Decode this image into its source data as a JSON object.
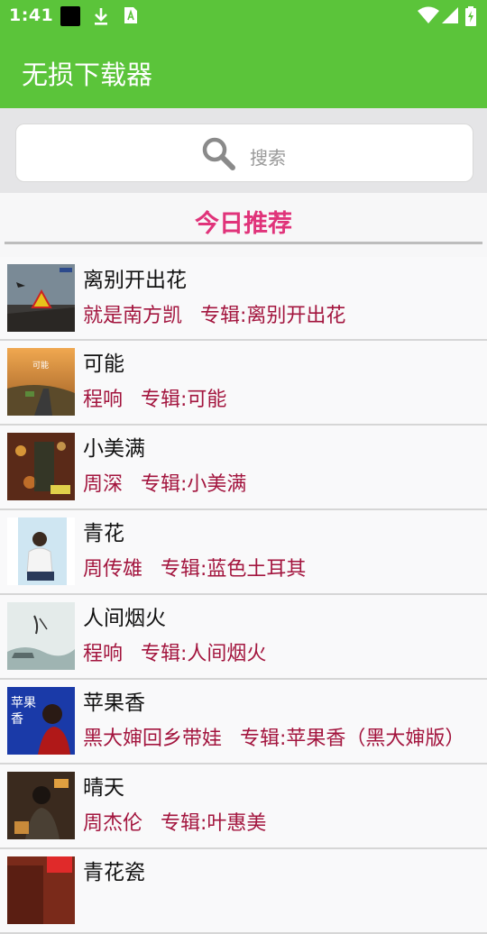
{
  "status_bar": {
    "time": "1:41",
    "icons": [
      "notification-black-square-icon",
      "download-icon",
      "a-app-icon",
      "wifi-icon",
      "signal-icon",
      "battery-charging-icon"
    ]
  },
  "app_bar": {
    "title": "无损下载器"
  },
  "search": {
    "placeholder": "搜索"
  },
  "section": {
    "title": "今日推荐"
  },
  "songs": [
    {
      "title": "离别开出花",
      "artist": "就是南方凯",
      "album": "专辑:离别开出花"
    },
    {
      "title": "可能",
      "artist": "程响",
      "album": "专辑:可能"
    },
    {
      "title": "小美满",
      "artist": "周深",
      "album": "专辑:小美满"
    },
    {
      "title": "青花",
      "artist": "周传雄",
      "album": "专辑:蓝色土耳其"
    },
    {
      "title": "人间烟火",
      "artist": "程响",
      "album": "专辑:人间烟火"
    },
    {
      "title": "苹果香",
      "artist": "黑大婶回乡带娃",
      "album": "专辑:苹果香（黑大婶版）"
    },
    {
      "title": "晴天",
      "artist": "周杰伦",
      "album": "专辑:叶惠美"
    },
    {
      "title": "青花瓷",
      "artist": "",
      "album": ""
    }
  ],
  "colors": {
    "primary": "#5bc43a",
    "accent": "#e0337a",
    "meta_text": "#a3153e"
  }
}
